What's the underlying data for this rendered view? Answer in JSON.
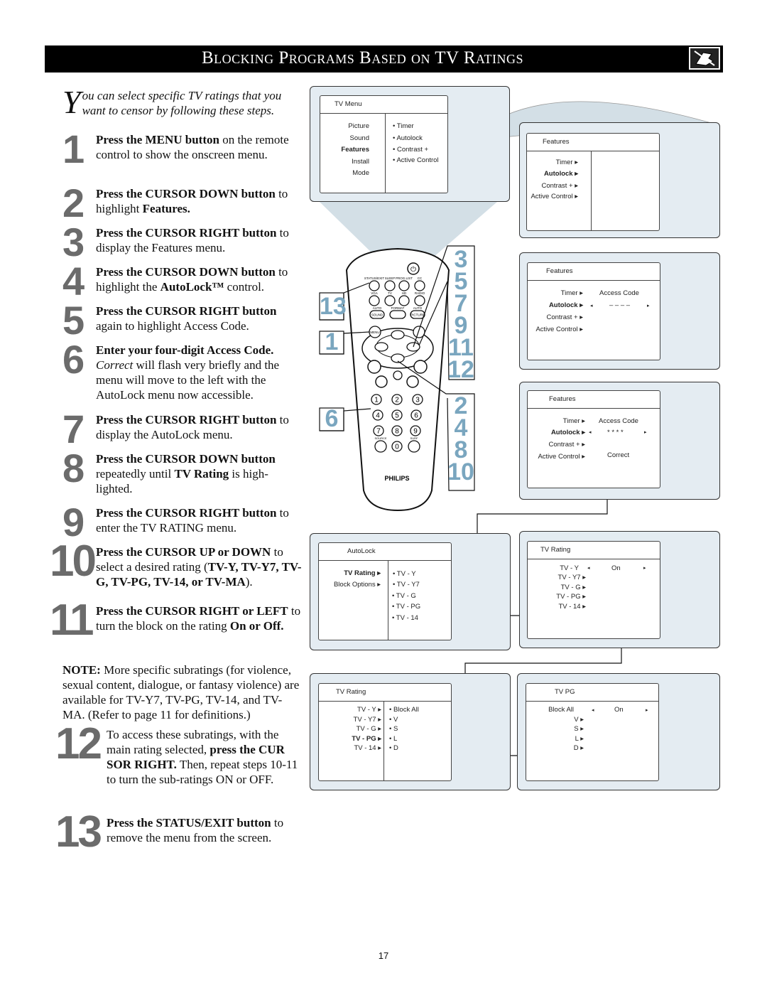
{
  "header": {
    "title": "Blocking Programs Based on TV Ratings",
    "icon": "remote-hand-icon"
  },
  "intro": {
    "dropcap": "Y",
    "text": "ou can select specific TV ratings that you want to censor by following these steps."
  },
  "steps": [
    {
      "num": "1",
      "bold": "Press the MENU button",
      "rest": " on the remote control to show the onscreen menu."
    },
    {
      "num": "2",
      "bold": "Press the CURSOR DOWN button",
      "rest": " to highlight ",
      "bold2": "Features."
    },
    {
      "num": "3",
      "bold": "Press the CURSOR RIGHT button",
      "rest": " to display the Features menu."
    },
    {
      "num": "4",
      "bold": "Press the CURSOR DOWN button",
      "rest": " to highlight the ",
      "bold2": "AutoLock™",
      "rest2": " control."
    },
    {
      "num": "5",
      "bold": "Press the CURSOR RIGHT button",
      "rest": " again to highlight Access Code."
    },
    {
      "num": "6",
      "bold": "Enter your four-digit Access Code.",
      "italic": "Correct",
      "rest": " will flash very briefly and the menu will move to the left with the AutoLock menu now accessible."
    },
    {
      "num": "7",
      "bold": "Press the CURSOR RIGHT button",
      "rest": " to display the AutoLock menu."
    },
    {
      "num": "8",
      "bold": "Press the CURSOR DOWN button",
      "rest": " repeatedly until ",
      "bold2": "TV Rating",
      "rest2": " is high-lighted."
    },
    {
      "num": "9",
      "bold": "Press the CURSOR RIGHT button",
      "rest": " to enter the TV RATING menu."
    },
    {
      "num": "10",
      "bold": "Press the CURSOR UP or DOWN",
      "rest": " to select a desired rating (",
      "bold2": "TV-Y, TV-Y7, TV-G, TV-PG, TV-14, or TV-MA",
      "rest2": ")."
    },
    {
      "num": "11",
      "bold": "Press the CURSOR RIGHT or LEFT",
      "rest": " to turn the block on the rating ",
      "bold2": "On or Off."
    },
    {
      "num": "12",
      "pre": "To access these subratings, with the main rating selected, ",
      "bold": "press the CUR SOR RIGHT.",
      "rest": " Then, repeat steps 10-11 to turn the sub-ratings ON or OFF."
    },
    {
      "num": "13",
      "bold": "Press the STATUS/EXIT button",
      "rest": " to remove the menu from the screen."
    }
  ],
  "note": {
    "label": "NOTE:",
    "text": " More specific subratings (for violence, sexual content, dialogue, or fantasy violence) are available for TV-Y7, TV-PG, TV-14, and TV-MA. (Refer to page 11 for definitions.)"
  },
  "menus": {
    "tv_menu": {
      "title": "TV Menu",
      "left": [
        "Picture",
        "Sound",
        "Features",
        "Install",
        "Mode"
      ],
      "left_selected": "Features",
      "right": [
        "• Timer",
        "• Autolock",
        "• Contrast +",
        "• Active Control"
      ]
    },
    "features_1": {
      "title": "Features",
      "left": [
        "Timer ▸",
        "Autolock ▸",
        "Contrast + ▸",
        "Active Control ▸"
      ],
      "left_selected": "Autolock ▸"
    },
    "features_2": {
      "title": "Features",
      "left": [
        "Timer ▸",
        "Autolock ▸",
        "Contrast + ▸",
        "Active Control ▸"
      ],
      "right_label": "Access Code",
      "code_value": "– – – –",
      "arrow_left": "◂",
      "arrow_right": "▸"
    },
    "features_3": {
      "title": "Features",
      "left": [
        "Timer ▸",
        "Autolock ▸",
        "Contrast + ▸",
        "Active Control ▸"
      ],
      "right_label": "Access Code",
      "code_value": "* * * *",
      "status": "Correct",
      "arrow_left": "◂",
      "arrow_right": "▸"
    },
    "autolock": {
      "title": "AutoLock",
      "left": [
        "TV Rating ▸",
        "Block Options ▸"
      ],
      "left_selected": "TV Rating ▸",
      "right": [
        "• TV  -  Y",
        "• TV  -  Y7",
        "• TV  -  G",
        "• TV  -  PG",
        "• TV  -  14"
      ]
    },
    "tv_rating_1": {
      "title": "TV Rating",
      "left": [
        "TV  -  Y",
        "TV  -  Y7 ▸",
        "TV  -  G ▸",
        "TV  -  PG ▸",
        "TV  -  14 ▸"
      ],
      "value": "On",
      "arrow_left": "◂",
      "arrow_right": "▸"
    },
    "tv_rating_2": {
      "title": "TV Rating",
      "left": [
        "TV  -  Y ▸",
        "TV  -  Y7 ▸",
        "TV  -  G ▸",
        "TV  -  PG ▸",
        "TV  -  14 ▸"
      ],
      "left_selected": "TV  -  PG ▸",
      "right": [
        "• Block All",
        "• V",
        "• S",
        "• L",
        "• D"
      ]
    },
    "tv_pg": {
      "title": "TV PG",
      "left": [
        "Block All",
        "V ▸",
        "S ▸",
        "L ▸",
        "D ▸"
      ],
      "value": "On",
      "arrow_left": "◂",
      "arrow_right": "▸"
    }
  },
  "remote": {
    "brand": "PHILIPS",
    "top_labels": [
      "STATUS/EXIT",
      "SLEEP",
      "PROG.LIST",
      "CC"
    ],
    "row2_labels": [
      "VGA",
      "TV",
      "HD",
      "RADIO"
    ],
    "row3_labels": [
      "AUTO",
      "FORMAT",
      "AUTO"
    ],
    "sound_label": "SOUND",
    "picture_label": "PICTURE",
    "menu_label": "MENU",
    "digits": [
      "1",
      "2",
      "3",
      "4",
      "5",
      "6",
      "7",
      "8",
      "9",
      "0"
    ],
    "source_label": "SOURCE",
    "surf_label": "SURF",
    "callouts": {
      "status_exit": "13",
      "menu": "1",
      "digits": "6",
      "cursor_right": [
        "3",
        "5",
        "7",
        "9",
        "11",
        "12"
      ],
      "cursor_down": [
        "2",
        "4",
        "8",
        "10"
      ]
    }
  },
  "footer": {
    "page_number": "17"
  }
}
